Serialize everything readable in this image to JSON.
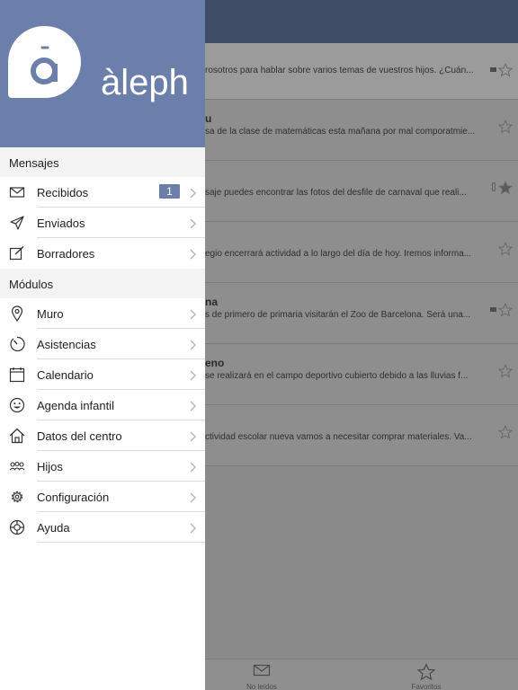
{
  "brand": {
    "name": "àleph"
  },
  "drawer": {
    "sections": [
      {
        "title": "Mensajes",
        "items": [
          {
            "label": "Recibidos",
            "icon": "envelope-icon",
            "badge": "1"
          },
          {
            "label": "Enviados",
            "icon": "paper-plane-icon"
          },
          {
            "label": "Borradores",
            "icon": "edit-icon"
          }
        ]
      },
      {
        "title": "Módulos",
        "items": [
          {
            "label": "Muro",
            "icon": "location-pin-icon"
          },
          {
            "label": "Asistencias",
            "icon": "stopwatch-icon"
          },
          {
            "label": "Calendario",
            "icon": "calendar-icon"
          },
          {
            "label": "Agenda infantil",
            "icon": "smiley-icon"
          },
          {
            "label": "Datos del centro",
            "icon": "home-icon"
          },
          {
            "label": "Hijos",
            "icon": "children-icon"
          },
          {
            "label": "Configuración",
            "icon": "gear-icon"
          },
          {
            "label": "Ayuda",
            "icon": "lifebuoy-icon"
          }
        ]
      }
    ]
  },
  "messages": [
    {
      "title": "",
      "preview": "rosotros para hablar sobre varios temas de vuestros hijos. ¿Cuán...",
      "starred": false,
      "flag": true,
      "attachment": false
    },
    {
      "title": "u",
      "preview": "sa de la clase de matemáticas esta mañana por mal comporatmie...",
      "starred": false,
      "flag": false,
      "attachment": false
    },
    {
      "title": "",
      "preview": "saje  puedes encontrar las fotos del desfile de carnaval que reali...",
      "starred": true,
      "flag": false,
      "attachment": true
    },
    {
      "title": "",
      "preview": "egio encerrará actividad a lo largo del día de hoy. Iremos informa...",
      "starred": false,
      "flag": false,
      "attachment": false
    },
    {
      "title": "na",
      "preview": "s de primero de primaria visitarán el Zoo de Barcelona. Será una...",
      "starred": false,
      "flag": true,
      "attachment": false
    },
    {
      "title": "eno",
      "preview": "se realizará en el campo deportivo cubierto debido a las lluvias f...",
      "starred": false,
      "flag": false,
      "attachment": false
    },
    {
      "title": "",
      "preview": "ctividad escolar nueva vamos a necesitar comprar materiales. Va...",
      "starred": false,
      "flag": false,
      "attachment": false
    }
  ],
  "tabbar": {
    "tabs": [
      {
        "label": "No leídos",
        "icon": "envelope-icon"
      },
      {
        "label": "Favoritos",
        "icon": "star-icon"
      }
    ]
  },
  "colors": {
    "brand": "#6b7faa",
    "header_dark": "#3f4d67"
  }
}
